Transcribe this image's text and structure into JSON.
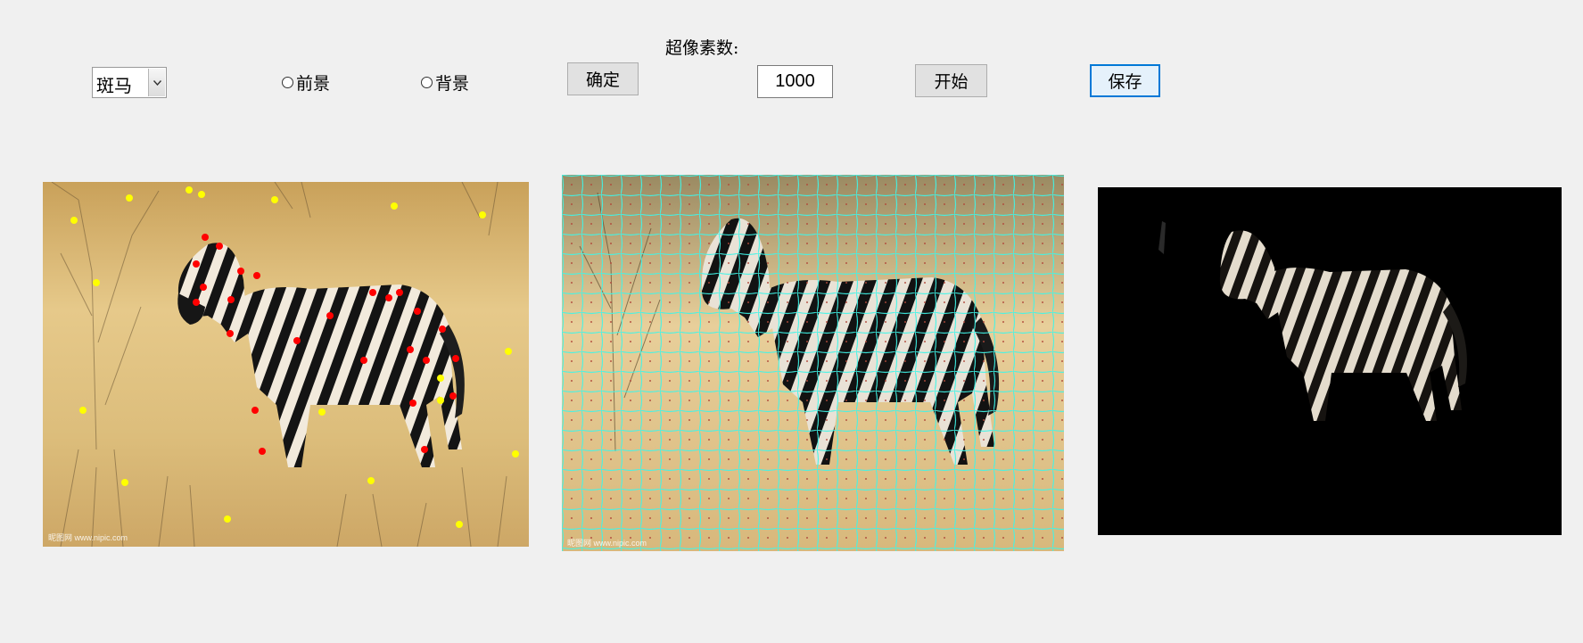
{
  "toolbar": {
    "class_select": {
      "value": "斑马"
    },
    "radio_foreground": {
      "label": "前景",
      "selected": false
    },
    "radio_background": {
      "label": "背景",
      "selected": false
    },
    "confirm_label": "确定",
    "superpixel_label": "超像素数:",
    "superpixel_value": "1000",
    "start_label": "开始",
    "save_label": "保存"
  },
  "panels": {
    "annotated": {
      "watermark_left": "昵图网 www.nipic.com"
    },
    "superpixel": {
      "watermark_left": "昵图网 www.nipic.com"
    },
    "result": {}
  },
  "colors": {
    "window_bg": "#f0f0f0",
    "foreground_marker": "#ff0000",
    "background_marker": "#ffff00",
    "superpixel_boundary": "#3ff5e8",
    "result_bg": "#000000"
  }
}
